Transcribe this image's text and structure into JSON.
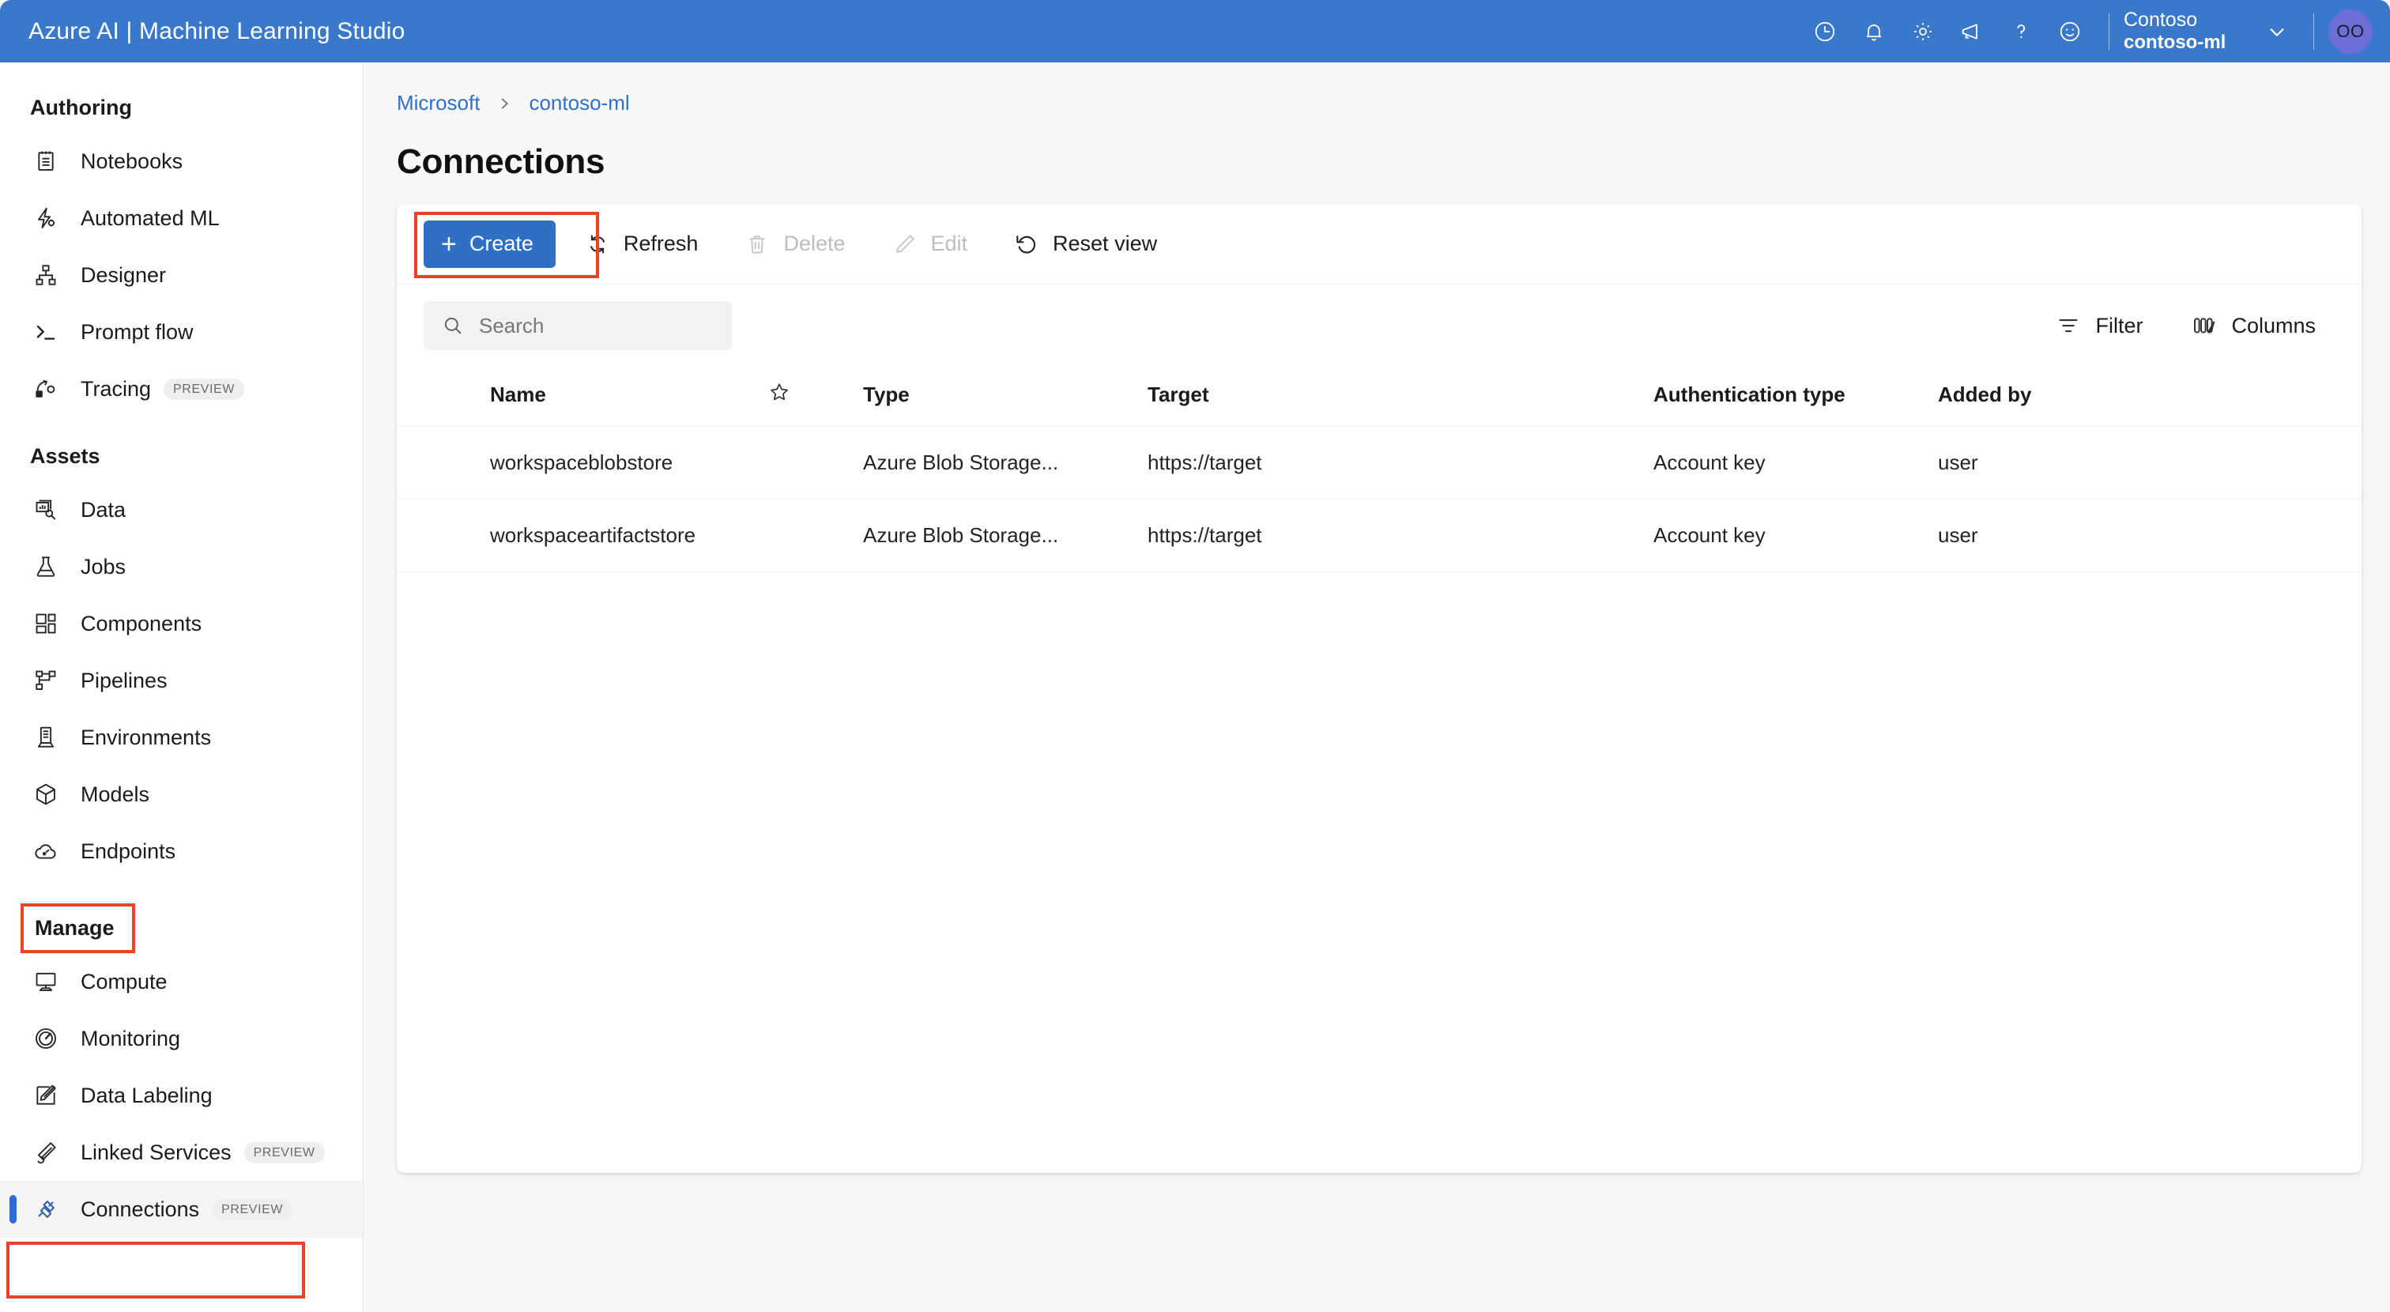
{
  "header": {
    "brand": "Azure AI | Machine Learning Studio",
    "icons": [
      {
        "name": "history-clock-icon",
        "label": "Recent"
      },
      {
        "name": "notification-bell-icon",
        "label": "Notifications"
      },
      {
        "name": "settings-gear-icon",
        "label": "Settings"
      },
      {
        "name": "feedback-megaphone-icon",
        "label": "Feedback"
      },
      {
        "name": "help-question-icon",
        "label": "Help"
      },
      {
        "name": "smiley-face-icon",
        "label": "Send a smile"
      }
    ],
    "tenant_name": "Contoso",
    "workspace_name": "contoso-ml",
    "avatar_initials": "OO",
    "bar_color": "#3a78c9"
  },
  "sidebar": {
    "sections": [
      {
        "title": "Authoring",
        "highlighted": false,
        "items": [
          {
            "label": "Notebooks",
            "icon": "notebook-icon",
            "badge": "",
            "selected": false
          },
          {
            "label": "Automated ML",
            "icon": "automated-ml-icon",
            "badge": "",
            "selected": false
          },
          {
            "label": "Designer",
            "icon": "designer-icon",
            "badge": "",
            "selected": false
          },
          {
            "label": "Prompt flow",
            "icon": "terminal-prompt-icon",
            "badge": "",
            "selected": false
          },
          {
            "label": "Tracing",
            "icon": "tracing-icon",
            "badge": "PREVIEW",
            "selected": false
          }
        ]
      },
      {
        "title": "Assets",
        "highlighted": false,
        "items": [
          {
            "label": "Data",
            "icon": "data-icon",
            "badge": "",
            "selected": false
          },
          {
            "label": "Jobs",
            "icon": "flask-jobs-icon",
            "badge": "",
            "selected": false
          },
          {
            "label": "Components",
            "icon": "components-icon",
            "badge": "",
            "selected": false
          },
          {
            "label": "Pipelines",
            "icon": "pipelines-icon",
            "badge": "",
            "selected": false
          },
          {
            "label": "Environments",
            "icon": "environments-icon",
            "badge": "",
            "selected": false
          },
          {
            "label": "Models",
            "icon": "models-cube-icon",
            "badge": "",
            "selected": false
          },
          {
            "label": "Endpoints",
            "icon": "endpoints-cloud-icon",
            "badge": "",
            "selected": false
          }
        ]
      },
      {
        "title": "Manage",
        "highlighted": true,
        "items": [
          {
            "label": "Compute",
            "icon": "compute-monitor-icon",
            "badge": "",
            "selected": false
          },
          {
            "label": "Monitoring",
            "icon": "monitoring-gauge-icon",
            "badge": "",
            "selected": false
          },
          {
            "label": "Data Labeling",
            "icon": "data-labeling-icon",
            "badge": "",
            "selected": false
          },
          {
            "label": "Linked Services",
            "icon": "linked-services-icon",
            "badge": "PREVIEW",
            "selected": false
          },
          {
            "label": "Connections",
            "icon": "connections-plug-icon",
            "badge": "PREVIEW",
            "selected": true
          }
        ]
      }
    ],
    "annotation_color": "#e8442a"
  },
  "main": {
    "breadcrumb": [
      {
        "label": "Microsoft"
      },
      {
        "label": "contoso-ml"
      }
    ],
    "breadcrumb_separator": "›",
    "page_title": "Connections",
    "toolbar": {
      "create_label": "Create",
      "create_plus": "+",
      "refresh_label": "Refresh",
      "delete_label": "Delete",
      "edit_label": "Edit",
      "reset_view_label": "Reset view",
      "delete_disabled": true,
      "edit_disabled": true
    },
    "search": {
      "placeholder": "Search",
      "value": ""
    },
    "filter_label": "Filter",
    "columns_label": "Columns",
    "table": {
      "headers": [
        "Name",
        "",
        "Type",
        "Target",
        "Authentication type",
        "Added by"
      ],
      "rows": [
        {
          "name": "workspaceblobstore",
          "type": "Azure Blob Storage...",
          "target": "https://target",
          "auth": "Account key",
          "added_by": "user"
        },
        {
          "name": "workspaceartifactstore",
          "type": "Azure Blob Storage...",
          "target": "https://target",
          "auth": "Account key",
          "added_by": "user"
        }
      ]
    }
  }
}
